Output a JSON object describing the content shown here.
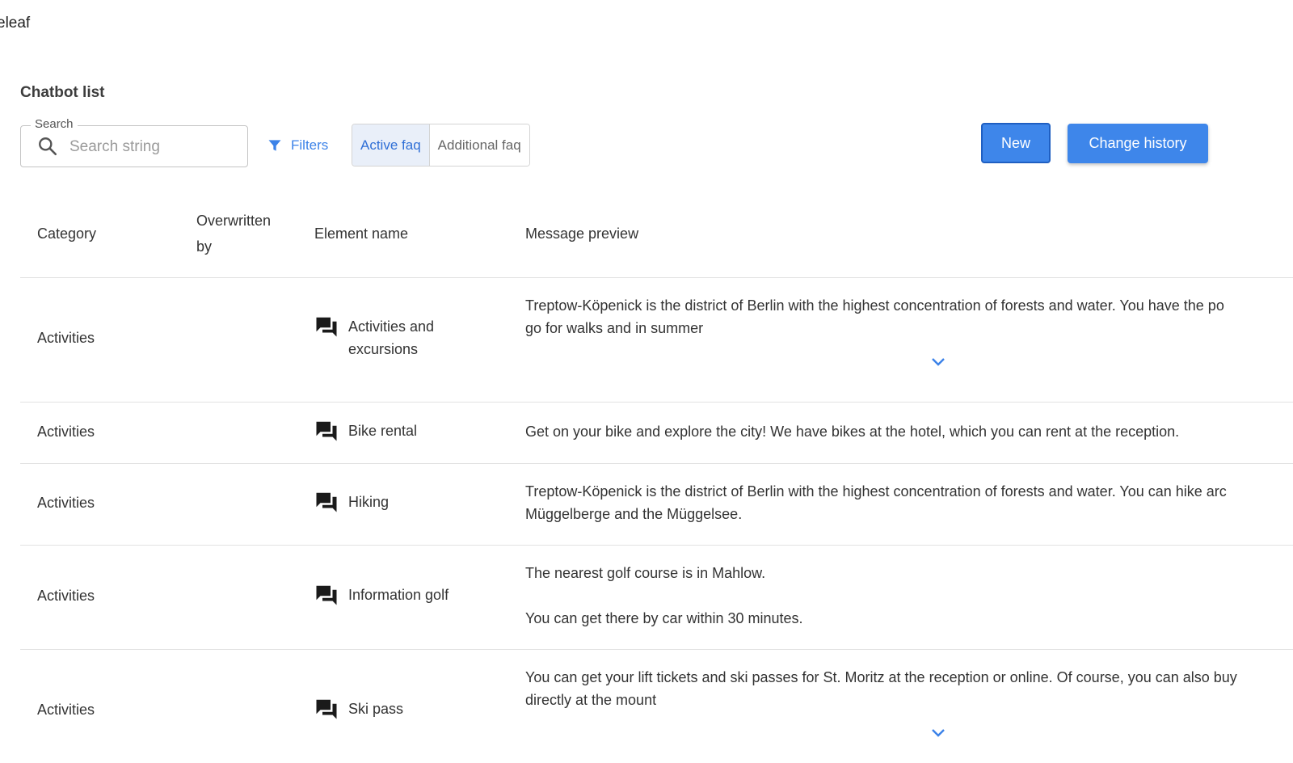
{
  "app": {
    "name": "eleaf"
  },
  "page": {
    "title": "Chatbot list"
  },
  "search": {
    "label": "Search",
    "placeholder": "Search string",
    "value": ""
  },
  "filters": {
    "label": "Filters"
  },
  "faq_toggle": {
    "active_label": "Active faq",
    "additional_label": "Additional faq",
    "selected": "Active faq"
  },
  "actions": {
    "new_label": "New",
    "history_label": "Change history"
  },
  "colors": {
    "accent": "#3e86ea",
    "toggle_active_bg": "#e9eff9",
    "divider": "#e2e2e2"
  },
  "table": {
    "headers": {
      "category": "Category",
      "overwritten": "Overwritten by",
      "element": "Element name",
      "preview": "Message preview"
    },
    "rows": [
      {
        "category": "Activities",
        "overwritten_by": "",
        "element_icon": "chat-icon",
        "element_name": "Activities and excursions",
        "preview_lines": [
          "Treptow-Köpenick is the district of Berlin with the highest concentration of forests and water. You have the po",
          "go for walks and in summer"
        ],
        "expandable": true
      },
      {
        "category": "Activities",
        "overwritten_by": "",
        "element_icon": "chat-icon",
        "element_name": "Bike rental",
        "preview_lines": [
          "Get on your bike and explore the city! We have bikes at the hotel, which you can rent at the reception."
        ],
        "expandable": false
      },
      {
        "category": "Activities",
        "overwritten_by": "",
        "element_icon": "chat-icon",
        "element_name": "Hiking",
        "preview_lines": [
          "Treptow-Köpenick is the district of Berlin with the highest concentration of forests and water. You can hike arc",
          "Müggelberge and the Müggelsee."
        ],
        "expandable": false
      },
      {
        "category": "Activities",
        "overwritten_by": "",
        "element_icon": "chat-icon",
        "element_name": "Information golf",
        "preview_lines": [
          "The nearest golf course is in Mahlow.",
          "You can get there by car within 30 minutes."
        ],
        "expandable": false
      },
      {
        "category": "Activities",
        "overwritten_by": "",
        "element_icon": "chat-icon",
        "element_name": "Ski pass",
        "preview_lines": [
          "You can get your lift tickets and ski passes for St. Moritz at the reception or online. Of course, you can also buy",
          "directly at the mount"
        ],
        "expandable": true
      }
    ]
  }
}
